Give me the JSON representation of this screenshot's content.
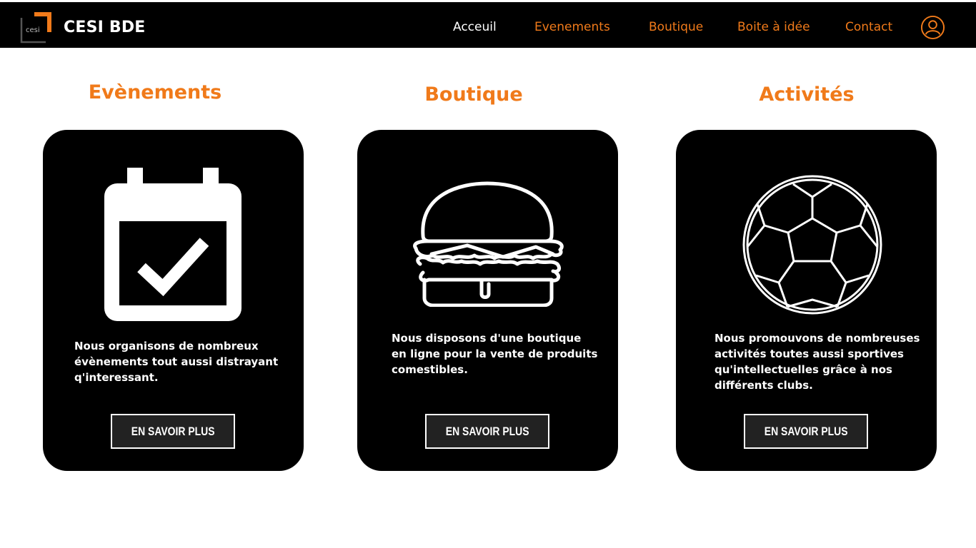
{
  "header": {
    "brand": "CESI BDE",
    "logo_text": "cesi",
    "nav": [
      {
        "label": "Acceuil",
        "active": true
      },
      {
        "label": "Evenements",
        "active": false
      },
      {
        "label": "Boutique",
        "active": false
      },
      {
        "label": "Boite à idée",
        "active": false
      },
      {
        "label": "Contact",
        "active": false
      }
    ],
    "user_icon": "user-circle-icon"
  },
  "sections": [
    {
      "title": "Evènements",
      "icon": "calendar-check-icon",
      "text": "Nous organisons de nombreux évènements tout aussi distrayant q'interessant.",
      "button": "EN SAVOIR PLUS"
    },
    {
      "title": "Boutique",
      "icon": "burger-icon",
      "text": "Nous disposons d'une boutique en ligne pour la vente de produits comestibles.",
      "button": "EN SAVOIR PLUS"
    },
    {
      "title": "Activités",
      "icon": "soccer-ball-icon",
      "text": "Nous promouvons de nombreuses activités toutes aussi sportives qu'intellectuelles grâce à nos différents clubs.",
      "button": "EN SAVOIR PLUS"
    }
  ],
  "colors": {
    "accent": "#f07a1a",
    "background": "#ffffff",
    "card": "#000000",
    "text_on_dark": "#ffffff"
  }
}
